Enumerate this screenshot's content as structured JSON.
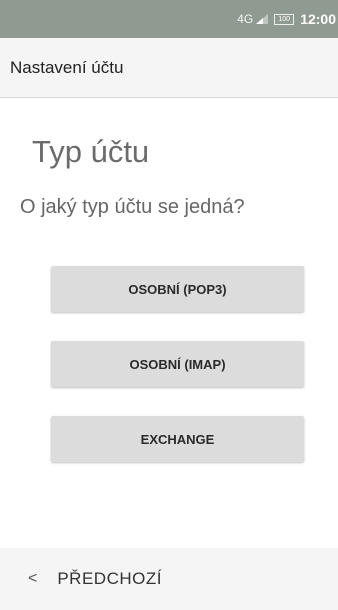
{
  "status_bar": {
    "network": "4G",
    "battery": "100",
    "time": "12:00",
    "background_color": "#8f9a90"
  },
  "app_bar": {
    "title": "Nastavení účtu"
  },
  "main": {
    "heading": "Typ účtu",
    "question": "O jaký typ účtu se jedná?",
    "buttons": [
      {
        "label": "OSOBNÍ (POP3)"
      },
      {
        "label": "OSOBNÍ (IMAP)"
      },
      {
        "label": "EXCHANGE"
      }
    ]
  },
  "bottom_bar": {
    "back_label": "PŘEDCHOZÍ",
    "back_icon": "chevron-left-icon"
  }
}
